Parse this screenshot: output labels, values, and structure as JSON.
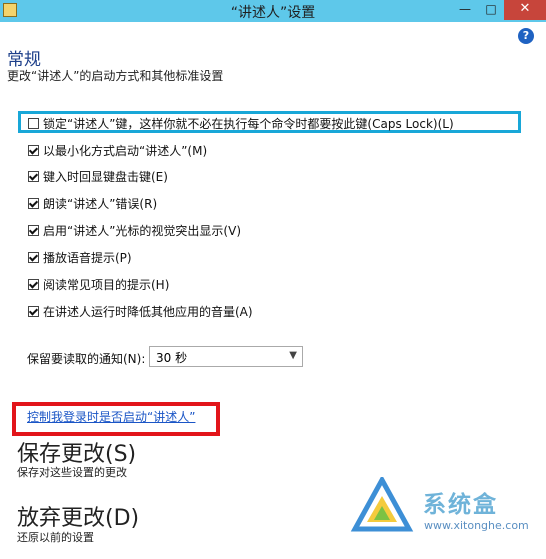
{
  "window": {
    "title": "“讲述人”设置",
    "minimize_glyph": "—",
    "maximize_glyph": "□",
    "close_glyph": "✕"
  },
  "help": {
    "glyph": "?"
  },
  "header": {
    "title": "常规",
    "subtitle": "更改“讲述人”的启动方式和其他标准设置"
  },
  "options": [
    {
      "label": "锁定“讲述人”键，这样你就不必在执行每个命令时都要按此键(Caps Lock)(L)",
      "checked": false
    },
    {
      "label": "以最小化方式启动“讲述人”(M)",
      "checked": true
    },
    {
      "label": "键入时回显键盘击键(E)",
      "checked": true
    },
    {
      "label": "朗读“讲述人”错误(R)",
      "checked": true
    },
    {
      "label": "启用“讲述人”光标的视觉突出显示(V)",
      "checked": true
    },
    {
      "label": "播放语音提示(P)",
      "checked": true
    },
    {
      "label": "阅读常见项目的提示(H)",
      "checked": true
    },
    {
      "label": "在讲述人运行时降低其他应用的音量(A)",
      "checked": true
    }
  ],
  "notification": {
    "label": "保留要读取的通知(N):",
    "value": "30 秒"
  },
  "link": {
    "label": "控制我登录时是否启动“讲述人”"
  },
  "save": {
    "title": "保存更改(S)",
    "desc": "保存对这些设置的更改"
  },
  "discard": {
    "title": "放弃更改(D)",
    "desc": "还原以前的设置"
  },
  "watermark": {
    "text": "系统盒",
    "url": "www.xitonghe.com",
    "colors": {
      "blue": "#3d8fd6",
      "yellow": "#f2c21b",
      "green": "#7cc243"
    }
  },
  "colors": {
    "titlebar": "#5ec8ea",
    "close": "#c7453b",
    "highlight_blue": "#18a7d8",
    "highlight_red": "#e2151a",
    "link": "#1a55c6",
    "heading": "#1d3f8a"
  }
}
